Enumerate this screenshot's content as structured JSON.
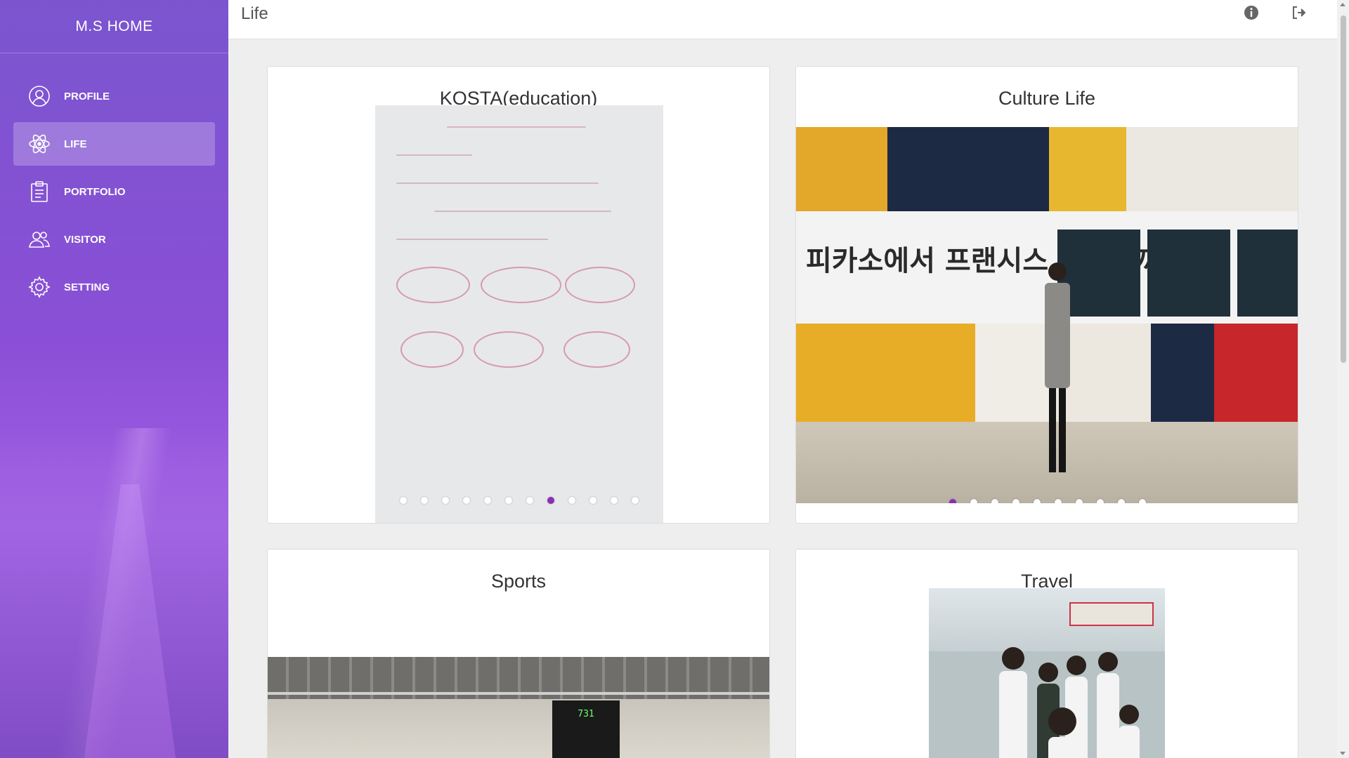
{
  "sidebar": {
    "brand": "M.S HOME",
    "items": [
      {
        "label": "PROFILE",
        "icon": "user-circle-icon",
        "active": false
      },
      {
        "label": "LIFE",
        "icon": "atom-icon",
        "active": true
      },
      {
        "label": "PORTFOLIO",
        "icon": "clipboard-icon",
        "active": false
      },
      {
        "label": "VISITOR",
        "icon": "users-icon",
        "active": false
      },
      {
        "label": "SETTING",
        "icon": "gear-icon",
        "active": false
      }
    ]
  },
  "header": {
    "title": "Life",
    "icons": [
      "info-icon",
      "logout-icon"
    ]
  },
  "cards": [
    {
      "title": "KOSTA(education)",
      "slide_count": 12,
      "active_slide": 8
    },
    {
      "title": "Culture Life",
      "slide_count": 10,
      "active_slide": 1,
      "banner_text": "피카소에서 프랜시스 베이컨까지"
    },
    {
      "title": "Sports",
      "scoreboard_text": "731"
    },
    {
      "title": "Travel"
    }
  ],
  "colors": {
    "sidebar_gradient_top": "#7b55cf",
    "sidebar_gradient_bottom": "#8b56cf",
    "active_dot": "#8a2fb5"
  }
}
